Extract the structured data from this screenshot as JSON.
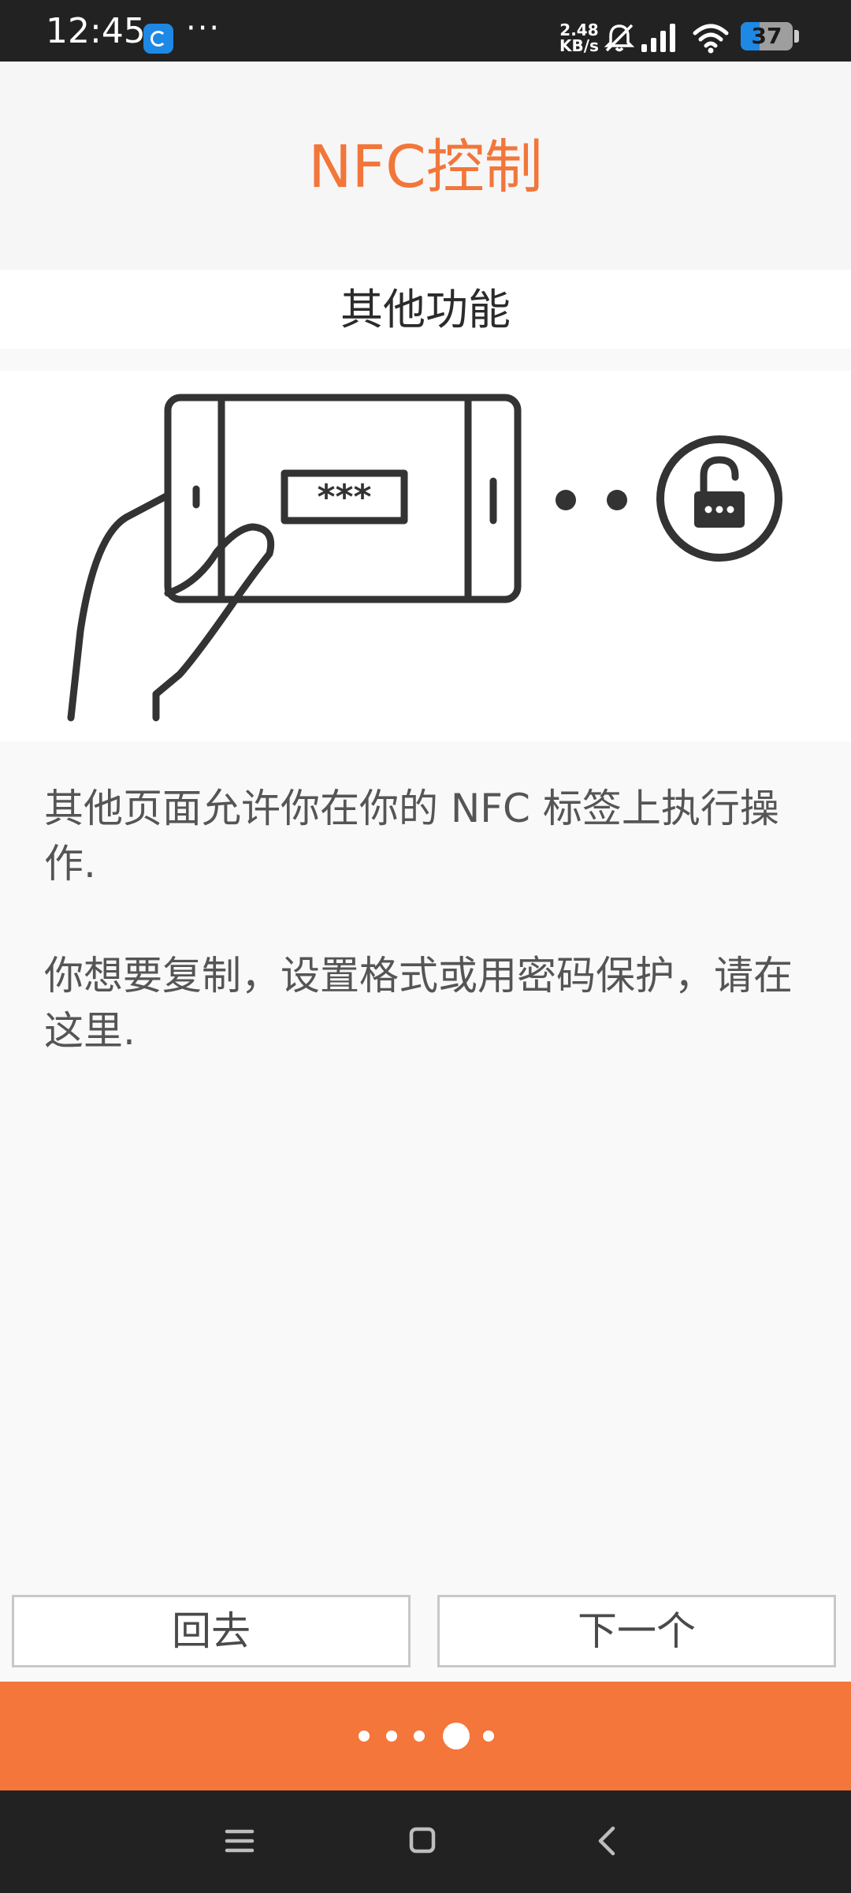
{
  "status_bar": {
    "time": "12:45",
    "more": "···",
    "speed_value": "2.48",
    "speed_unit": "KB/s",
    "battery": "37",
    "battery_level": 0.37,
    "icons": [
      "app-notification-icon",
      "bell-muted-icon",
      "signal-icon",
      "wifi-icon",
      "battery-icon"
    ]
  },
  "header": {
    "title": "NFC控制"
  },
  "section": {
    "title": "其他功能"
  },
  "illustration": {
    "password_mask": "***",
    "icons": [
      "hand-holding-phone-icon",
      "lock-icon"
    ]
  },
  "description": {
    "paragraph1": "其他页面允许你在你的 NFC 标签上执行操作.",
    "paragraph2": "你想要复制，设置格式或用密码保护，请在这里."
  },
  "buttons": {
    "back_label": "回去",
    "next_label": "下一个"
  },
  "pager": {
    "total": 5,
    "current_index": 3
  },
  "colors": {
    "accent": "#f5763b",
    "title": "#f2763a",
    "status_bar": "#222222",
    "battery_fill": "#1e88e5"
  },
  "system_nav": {
    "icons": [
      "menu-icon",
      "home-icon",
      "back-icon"
    ]
  }
}
